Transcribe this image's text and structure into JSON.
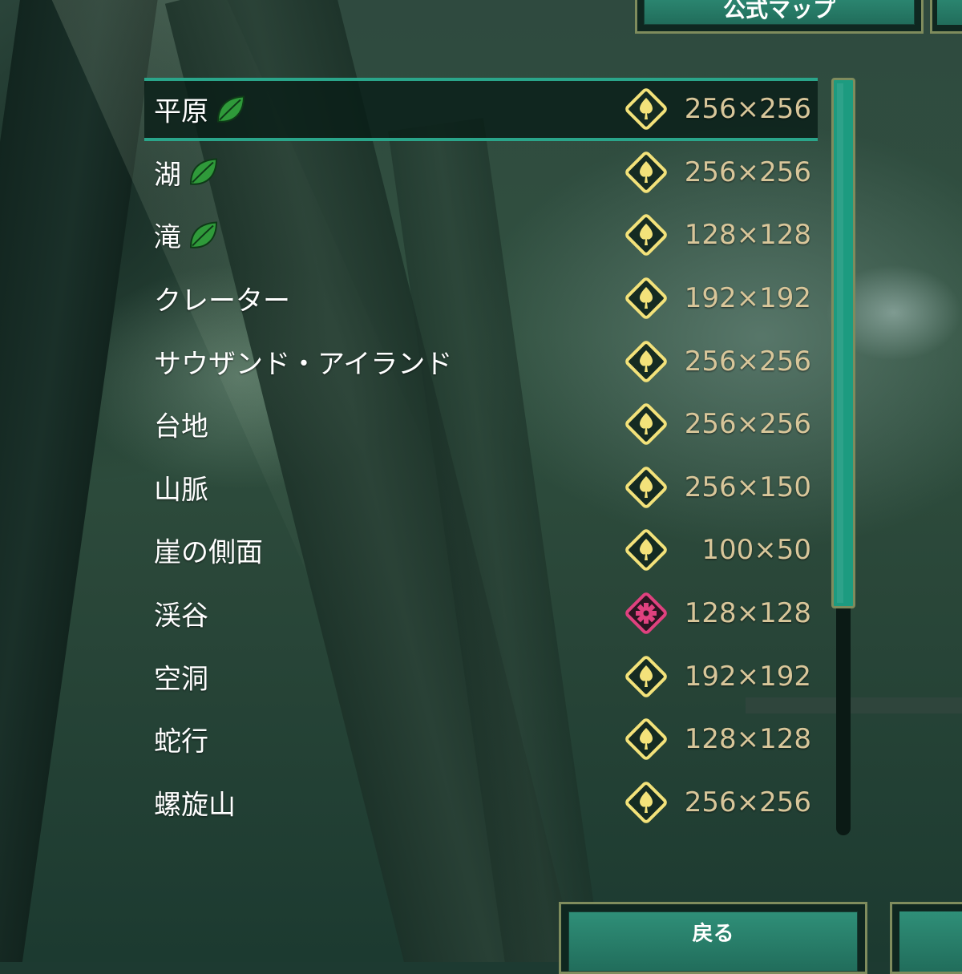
{
  "top_tab": {
    "label": "公式マップ"
  },
  "maps": [
    {
      "name": "平原",
      "leaf": true,
      "type": "standard",
      "size": "256×256",
      "selected": true
    },
    {
      "name": "湖",
      "leaf": true,
      "type": "standard",
      "size": "256×256"
    },
    {
      "name": "滝",
      "leaf": true,
      "type": "standard",
      "size": "128×128"
    },
    {
      "name": "クレーター",
      "leaf": false,
      "type": "standard",
      "size": "192×192"
    },
    {
      "name": "サウザンド・アイランド",
      "leaf": false,
      "type": "standard",
      "size": "256×256"
    },
    {
      "name": "台地",
      "leaf": false,
      "type": "standard",
      "size": "256×256"
    },
    {
      "name": "山脈",
      "leaf": false,
      "type": "standard",
      "size": "256×150"
    },
    {
      "name": "崖の側面",
      "leaf": false,
      "type": "standard",
      "size": "100×50"
    },
    {
      "name": "渓谷",
      "leaf": false,
      "type": "special",
      "size": "128×128"
    },
    {
      "name": "空洞",
      "leaf": false,
      "type": "standard",
      "size": "192×192"
    },
    {
      "name": "蛇行",
      "leaf": false,
      "type": "standard",
      "size": "128×128"
    },
    {
      "name": "螺旋山",
      "leaf": false,
      "type": "standard",
      "size": "256×256"
    }
  ],
  "bottom": {
    "back_label": "戻る"
  },
  "colors": {
    "accent_teal": "#2aa58a",
    "standard_icon": "#f3e27a",
    "special_icon": "#e0417f",
    "size_text": "#d8c69a",
    "leaf_green": "#2f9a3a"
  },
  "icons": {
    "standard": "diamond-leaf-icon",
    "special": "diamond-gear-icon",
    "leaf": "green-leaf-icon"
  },
  "scroll": {
    "visible_fraction": 0.7
  }
}
